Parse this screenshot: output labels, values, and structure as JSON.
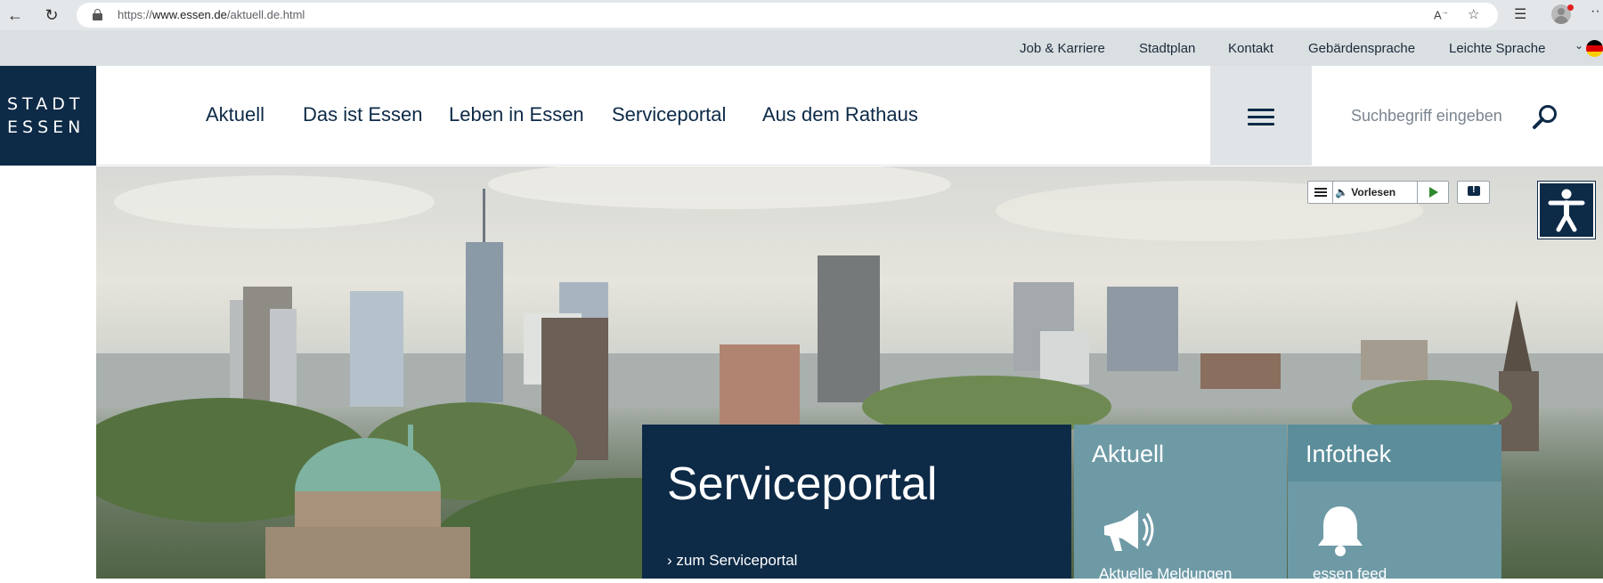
{
  "browser": {
    "url_prefix": "https://",
    "url_domain": "www.essen.de",
    "url_path": "/aktuell.de.html",
    "accent_color": "#0d2a47"
  },
  "service_nav": {
    "items": [
      "Job & Karriere",
      "Stadtplan",
      "Kontakt",
      "Gebärdensprache",
      "Leichte Sprache"
    ]
  },
  "logo": {
    "line1": "STADT",
    "line2": "ESSEN"
  },
  "main_nav": {
    "items": [
      "Aktuell",
      "Das ist Essen",
      "Leben in Essen",
      "Serviceportal",
      "Aus dem Rathaus"
    ]
  },
  "search": {
    "placeholder": "Suchbegriff eingeben"
  },
  "read_aloud": {
    "label": "Vorlesen"
  },
  "service_panel": {
    "title": "Serviceportal",
    "link": "zum Serviceportal"
  },
  "tiles": [
    {
      "title": "Aktuell",
      "label": "Aktuelle Meldungen",
      "icon": "megaphone-icon",
      "color": "#6e9aa6"
    },
    {
      "title": "Infothek",
      "label": "essen feed",
      "icon": "bell-icon",
      "color": "#6e9aa6"
    }
  ]
}
